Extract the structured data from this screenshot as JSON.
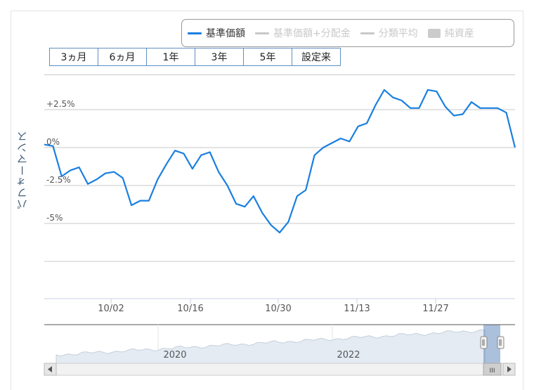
{
  "legend": [
    {
      "label": "基準価額",
      "color": "#1a7fe0",
      "kind": "line",
      "active": true
    },
    {
      "label": "基準価額+分配金",
      "color": "#c8c8c8",
      "kind": "line",
      "active": false
    },
    {
      "label": "分類平均",
      "color": "#c8c8c8",
      "kind": "line",
      "active": false
    },
    {
      "label": "純資産",
      "color": "#cccccc",
      "kind": "box",
      "active": false
    }
  ],
  "range_buttons": [
    "3ヵ月",
    "6ヵ月",
    "1年",
    "3年",
    "5年",
    "設定来"
  ],
  "navigator": {
    "labels": [
      "2020",
      "2022"
    ],
    "scroll_grip": "III"
  },
  "chart_data": {
    "type": "line",
    "title": "",
    "xlabel": "",
    "ylabel": "パフォーマンス",
    "x_ticks": [
      "10/02",
      "10/16",
      "10/30",
      "11/13",
      "11/27"
    ],
    "y_ticks": [
      "+2.5%",
      "0%",
      "-2.5%",
      "-5%"
    ],
    "y_tick_values": [
      2.5,
      0,
      -2.5,
      -5
    ],
    "ylim": [
      -10,
      5
    ],
    "grid": true,
    "series": [
      {
        "name": "基準価額",
        "color": "#1a7fe0",
        "values": [
          0.2,
          0.1,
          -1.9,
          -1.5,
          -1.3,
          -2.4,
          -2.1,
          -1.7,
          -1.6,
          -2.0,
          -3.8,
          -3.5,
          -3.5,
          -2.1,
          -1.1,
          -0.2,
          -0.4,
          -1.4,
          -0.5,
          -0.3,
          -1.6,
          -2.5,
          -3.7,
          -3.9,
          -3.2,
          -4.3,
          -5.1,
          -5.6,
          -4.9,
          -3.2,
          -2.8,
          -0.5,
          0.0,
          0.3,
          0.6,
          0.4,
          1.4,
          1.6,
          2.8,
          3.8,
          3.3,
          3.1,
          2.6,
          2.6,
          3.8,
          3.7,
          2.7,
          2.1,
          2.2,
          3.0,
          2.6,
          2.6,
          2.6,
          2.3,
          0.0
        ]
      }
    ]
  }
}
